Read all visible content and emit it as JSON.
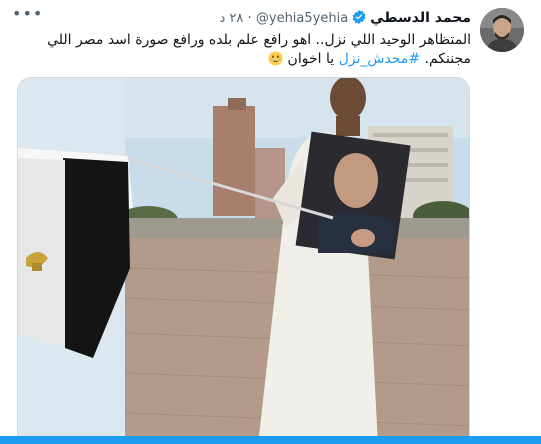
{
  "tweet": {
    "author_name": "محمد الدسطي",
    "handle": "@yehia5yehia",
    "separator": "·",
    "time": "٢٨ د",
    "text_before": "المتظاهر الوحيد اللي نزل.. اهو رافع علم بلده ورافع صورة اسد مصر اللي مجننكم.",
    "hashtag": "#محدش_نزل",
    "text_after": "يا اخوان",
    "emoji": "grinning-face-emoji"
  },
  "icons": {
    "more": "more-horizontal-icon",
    "verified": "verified-badge-icon"
  },
  "colors": {
    "accent": "#1d9bf0",
    "text": "#0f1419",
    "muted": "#536471"
  }
}
